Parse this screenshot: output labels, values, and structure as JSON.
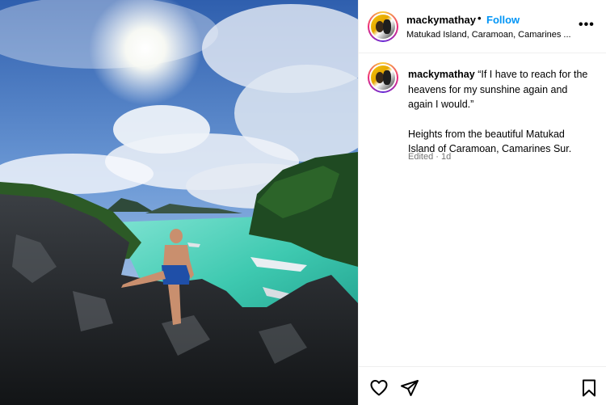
{
  "post": {
    "username": "mackymathay",
    "separator": "•",
    "follow_label": "Follow",
    "location": "Matukad Island, Caramoan, Camarines ...",
    "more_label": "•••",
    "caption_quote": "“If I have to reach for the heavens for my sunshine again and again I would.”",
    "caption_body": "Heights from the beautiful Matukad Island of Caramoan, Camarines Sur.",
    "meta": "Edited · 1d"
  },
  "icons": {
    "like": "heart-icon",
    "share": "send-icon",
    "save": "bookmark-icon",
    "more": "more-options-icon"
  },
  "colors": {
    "follow_blue": "#0095f6",
    "meta_gray": "#737373",
    "lagoon": "#3ec9b0",
    "sky": "#3a72c4"
  }
}
